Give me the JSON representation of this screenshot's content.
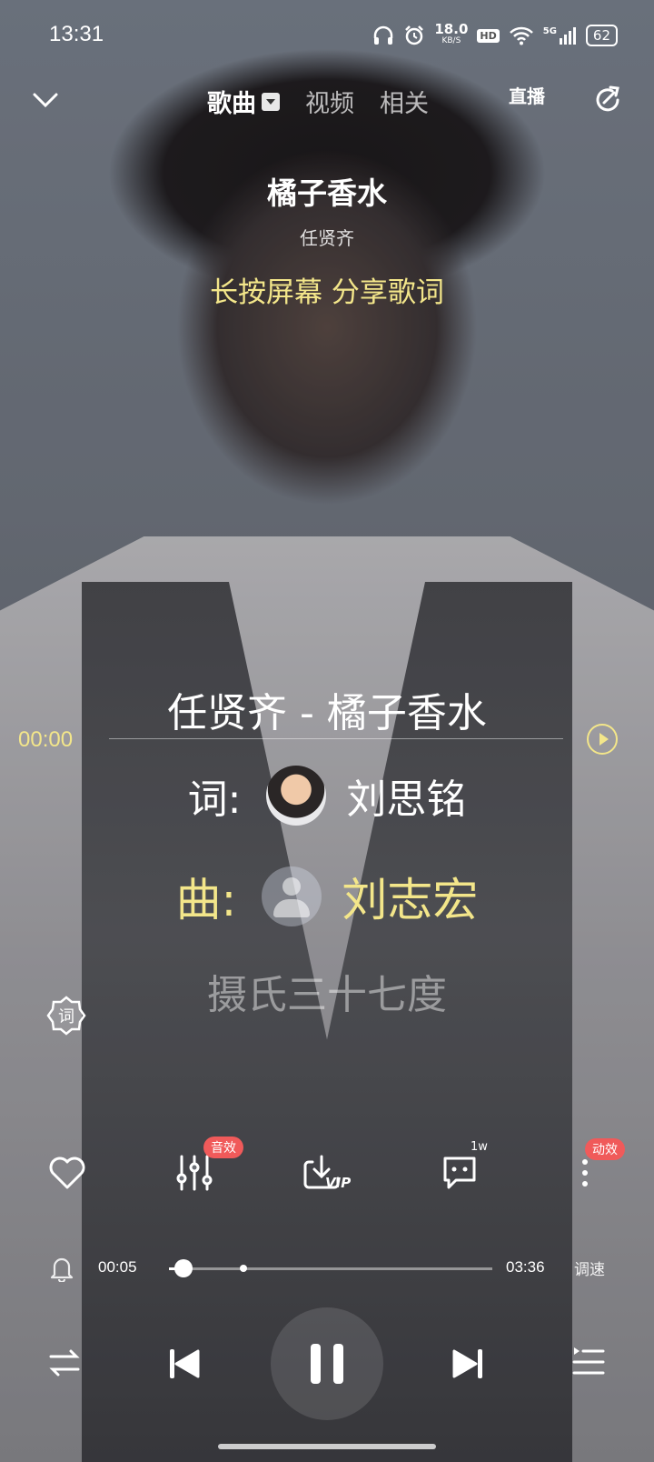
{
  "status": {
    "time": "13:31",
    "net_speed": "18.0",
    "net_unit": "KB/S",
    "hd": "HD",
    "signal": "5G",
    "battery": "62"
  },
  "nav": {
    "tabs": [
      "歌曲",
      "视频",
      "相关"
    ],
    "live": "直播"
  },
  "song": {
    "title": "橘子香水",
    "artist": "任贤齐",
    "hint": "长按屏幕 分享歌词"
  },
  "lyrics": {
    "current_line": "任贤齐 - 橘子香水",
    "position_time": "00:00",
    "lyricist_label": "词:",
    "lyricist": "刘思铭",
    "composer_label": "曲:",
    "composer": "刘志宏",
    "next_line": "摄氏三十七度"
  },
  "lyric_button": "词",
  "actions": {
    "effect_badge": "音效",
    "download_tag": "VIP",
    "comment_count": "1w",
    "motion_badge": "动效"
  },
  "player": {
    "current_time": "00:05",
    "total_time": "03:36",
    "progress": 0.046,
    "mark": 0.23,
    "speed_label": "调速"
  }
}
